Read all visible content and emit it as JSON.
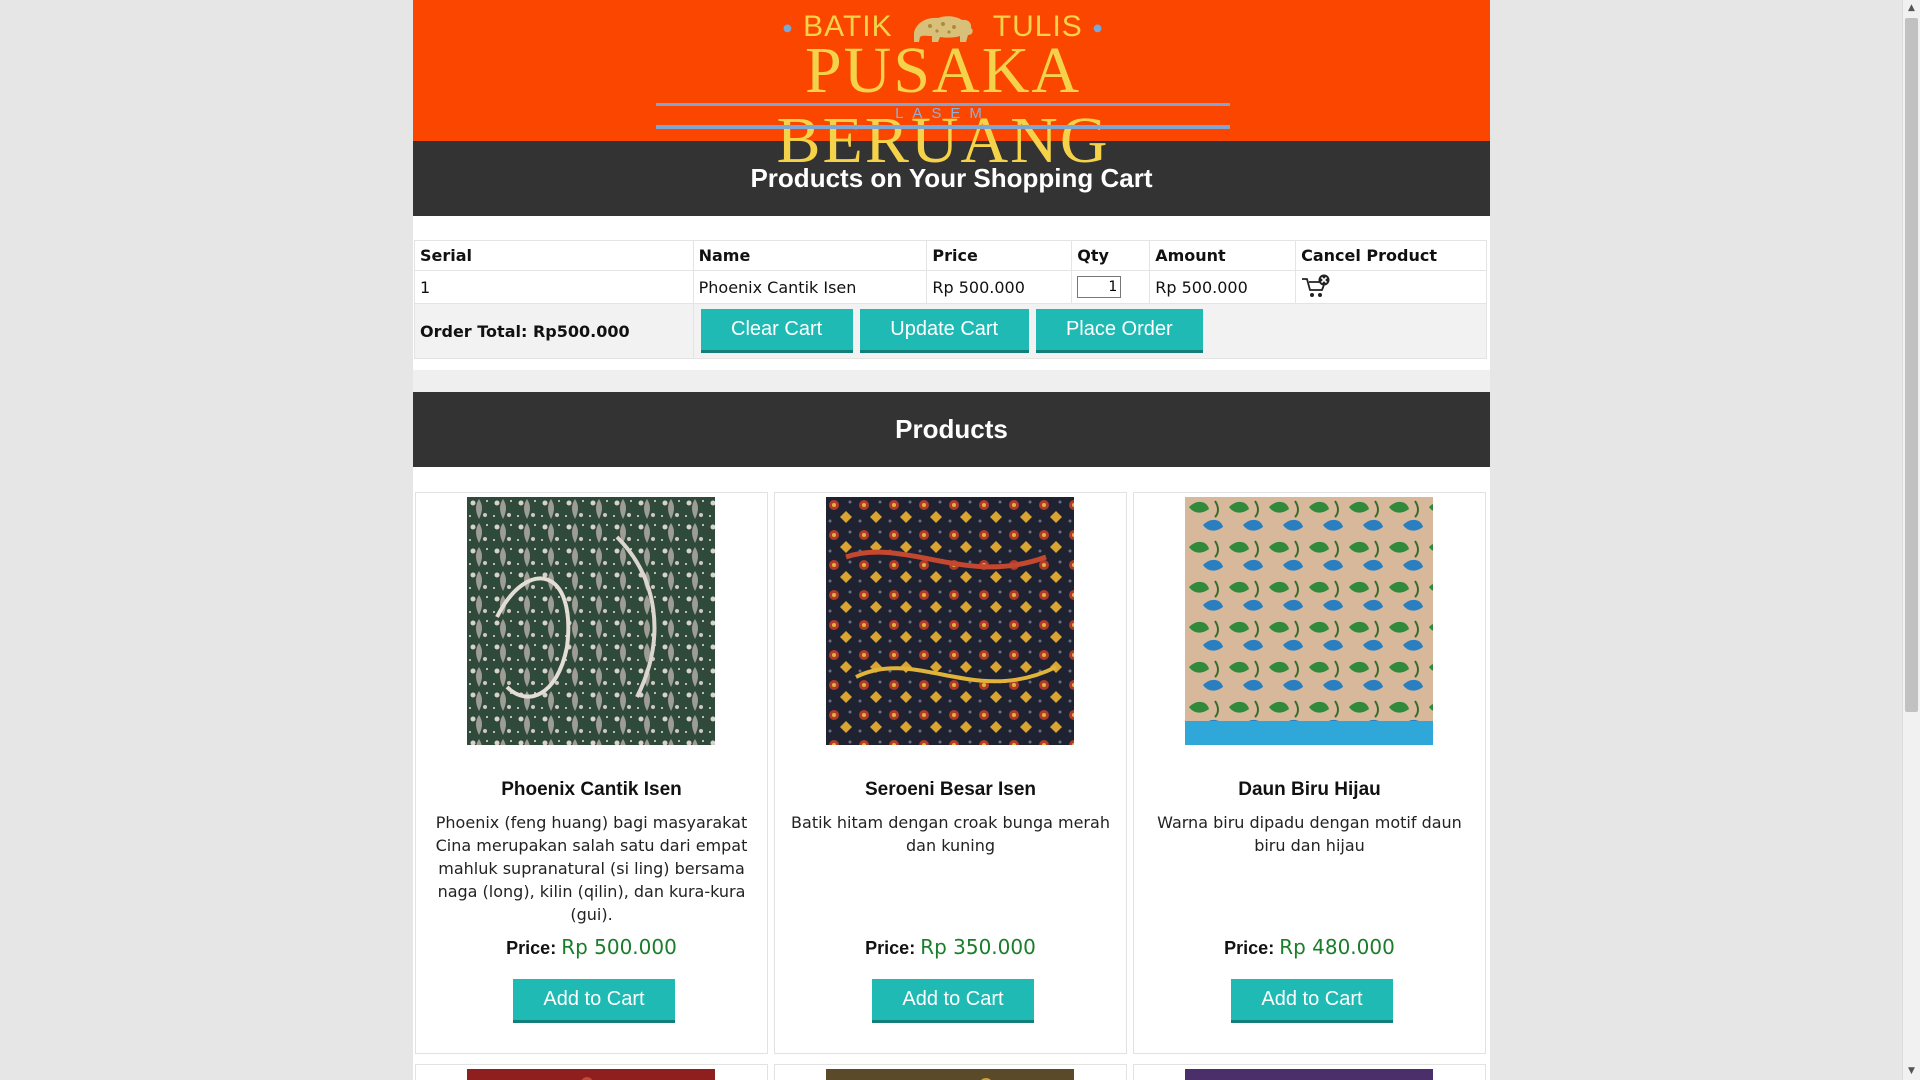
{
  "banner": {
    "logo_top_left": "BATIK",
    "logo_top_right": "TULIS",
    "logo_main": "PUSAKA BERUANG",
    "logo_sub": "LASEM"
  },
  "cart": {
    "title": "Products on Your Shopping Cart",
    "columns": [
      "Serial",
      "Name",
      "Price",
      "Qty",
      "Amount",
      "Cancel Product"
    ],
    "rows": [
      {
        "serial": "1",
        "name": "Phoenix Cantik Isen",
        "price": "Rp 500.000",
        "qty": "1",
        "amount": "Rp 500.000"
      }
    ],
    "order_total": "Order Total: Rp500.000",
    "buttons": {
      "clear": "Clear Cart",
      "update": "Update Cart",
      "place": "Place Order"
    }
  },
  "products": {
    "title": "Products",
    "price_label": "Price",
    "add_label": "Add to Cart",
    "items": [
      {
        "name": "Phoenix Cantik Isen",
        "desc": "Phoenix (feng huang) bagi masyarakat Cina merupakan salah satu dari empat mahluk supranatural (si ling) bersama naga (long), kilin (qilin), dan kura-kura (gui).",
        "price": "Rp 500.000"
      },
      {
        "name": "Seroeni Besar Isen",
        "desc": "Batik hitam dengan croak bunga merah dan kuning",
        "price": "Rp 350.000"
      },
      {
        "name": "Daun Biru Hijau",
        "desc": "Warna biru dipadu dengan motif daun biru dan hijau",
        "price": "Rp 480.000"
      }
    ]
  },
  "colors": {
    "banner": "#fb4600",
    "header_bar": "#333333",
    "button": "#1fbab4",
    "price": "#1a7d2a"
  }
}
